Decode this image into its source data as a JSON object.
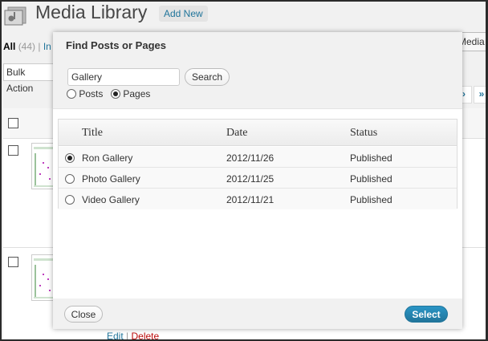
{
  "background_page": {
    "title": "Media Library",
    "add_new_label": "Add New",
    "filter_all": "All",
    "filter_all_count": "(44)",
    "filter_separator": "|",
    "filter_next_partial": "In",
    "media_button_partial": "Media",
    "bulk_actions_partial": "Bulk Action",
    "pager_next": "›",
    "pager_last": "»",
    "row_actions": {
      "edit": "Edit",
      "separator": "|",
      "delete": "Delete"
    }
  },
  "modal": {
    "title": "Find Posts or Pages",
    "search": {
      "value": "Gallery",
      "button_label": "Search"
    },
    "type_filter": {
      "selected": "Pages",
      "options": [
        {
          "label": "Posts",
          "selected": false
        },
        {
          "label": "Pages",
          "selected": true
        }
      ]
    },
    "results": {
      "columns": [
        "Title",
        "Date",
        "Status"
      ],
      "rows": [
        {
          "title": "Ron Gallery",
          "date": "2012/11/26",
          "status": "Published",
          "selected": true
        },
        {
          "title": "Photo Gallery",
          "date": "2012/11/25",
          "status": "Published",
          "selected": false
        },
        {
          "title": "Video Gallery",
          "date": "2012/11/21",
          "status": "Published",
          "selected": false
        }
      ]
    },
    "close_label": "Close",
    "select_label": "Select"
  },
  "colors": {
    "link": "#21759b",
    "delete": "#bc0b0b",
    "primary_button": "#21759b"
  }
}
